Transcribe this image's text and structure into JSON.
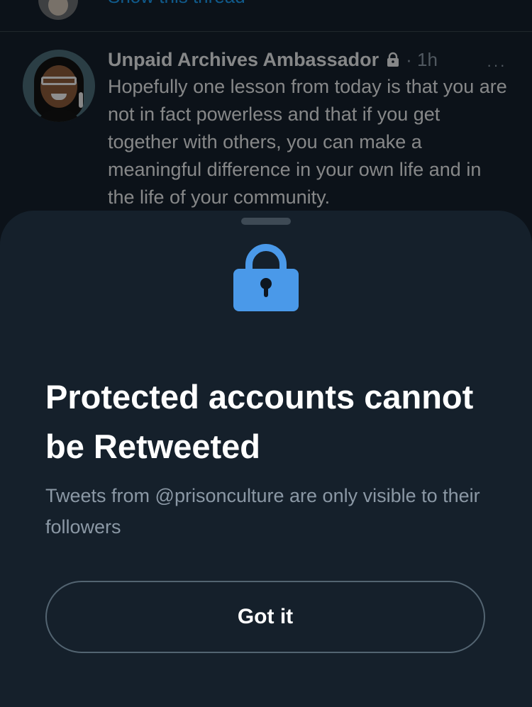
{
  "background": {
    "previous_link": "Show this thread",
    "tweet": {
      "author": "Unpaid Archives Ambassador",
      "time": "· 1h",
      "more": "···",
      "text": "Hopefully one lesson from today is that you are not in fact powerless and that if you get together with others, you can make a meaningful difference in your own life and in the life of your community."
    }
  },
  "sheet": {
    "title": "Protected accounts cannot be Retweeted",
    "description": "Tweets from @prisonculture are only visible to their followers",
    "button_label": "Got it",
    "icon": "lock-icon"
  },
  "colors": {
    "accent": "#4a99e9",
    "sheet_bg": "#15202b",
    "muted_text": "#8b98a5"
  }
}
